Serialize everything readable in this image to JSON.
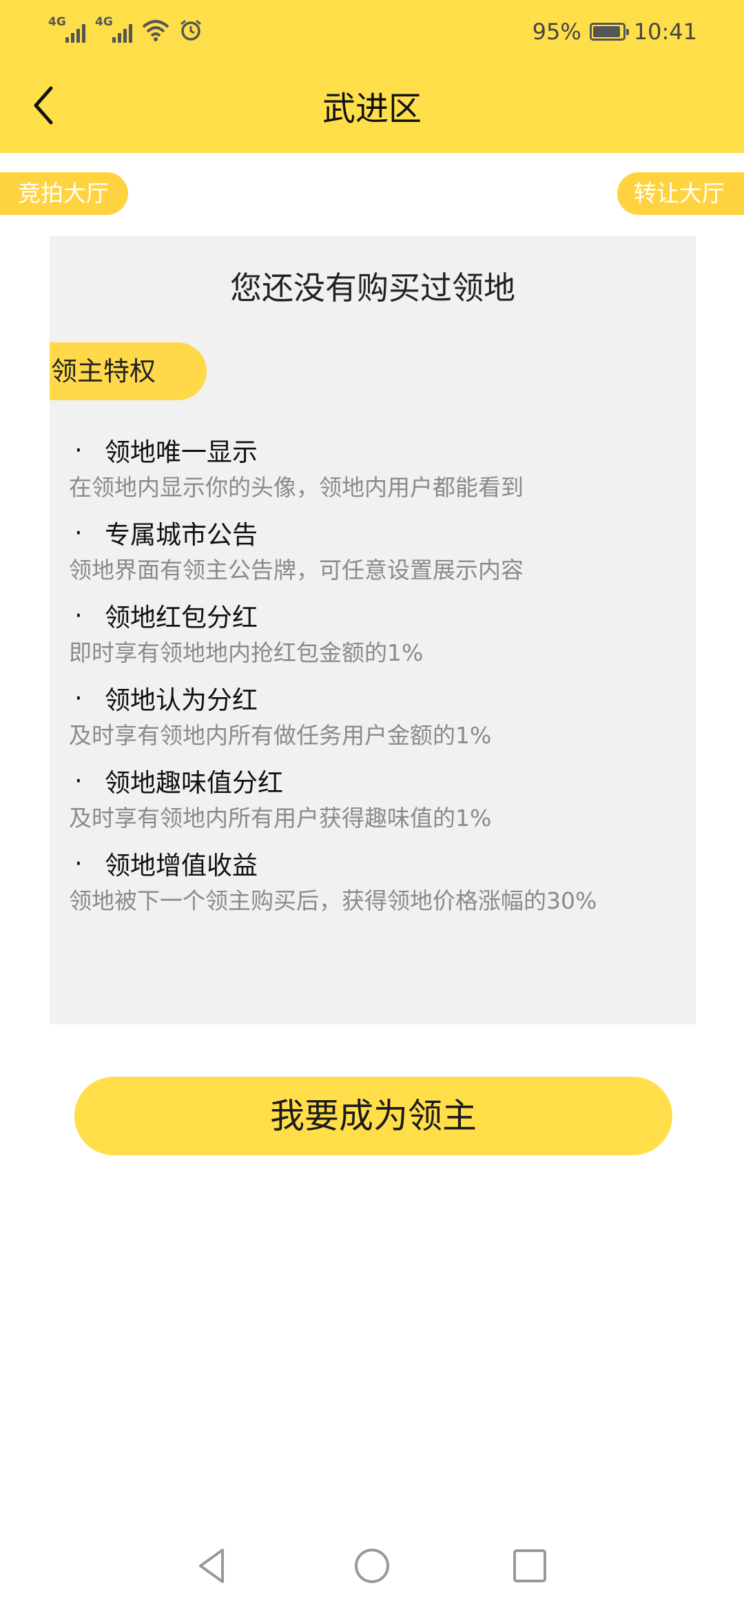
{
  "status_bar": {
    "network_1": "4G",
    "network_2": "4G",
    "battery_percent": "95%",
    "battery_level": 0.95,
    "time": "10:41",
    "icons": [
      "signal-icon",
      "signal-icon",
      "wifi-icon",
      "alarm-icon",
      "battery-icon"
    ]
  },
  "header": {
    "title": "武进区",
    "background_color": "#ffdf49",
    "back_icon": "chevron-left-icon"
  },
  "pills": {
    "left_label": "竞拍大厅",
    "right_label": "转让大厅",
    "color": "#ffd340"
  },
  "card": {
    "title": "您还没有购买过领地",
    "privilege_tag": "领主特权",
    "bullet": "·",
    "features": [
      {
        "title": "领地唯一显示",
        "desc": "在领地内显示你的头像，领地内用户都能看到"
      },
      {
        "title": "专属城市公告",
        "desc": "领地界面有领主公告牌，可任意设置展示内容"
      },
      {
        "title": "领地红包分红",
        "desc": "即时享有领地地内抢红包金额的1%"
      },
      {
        "title": "领地认为分红",
        "desc": "及时享有领地内所有做任务用户金额的1%"
      },
      {
        "title": "领地趣味值分红",
        "desc": "及时享有领地内所有用户获得趣味值的1%"
      },
      {
        "title": "领地增值收益",
        "desc": "领地被下一个领主购买后，获得领地价格涨幅的30%"
      }
    ]
  },
  "cta": {
    "label": "我要成为领主",
    "color": "#ffde4a"
  },
  "navbar": {
    "icons": [
      "nav-back-icon",
      "nav-home-icon",
      "nav-recent-icon"
    ]
  }
}
